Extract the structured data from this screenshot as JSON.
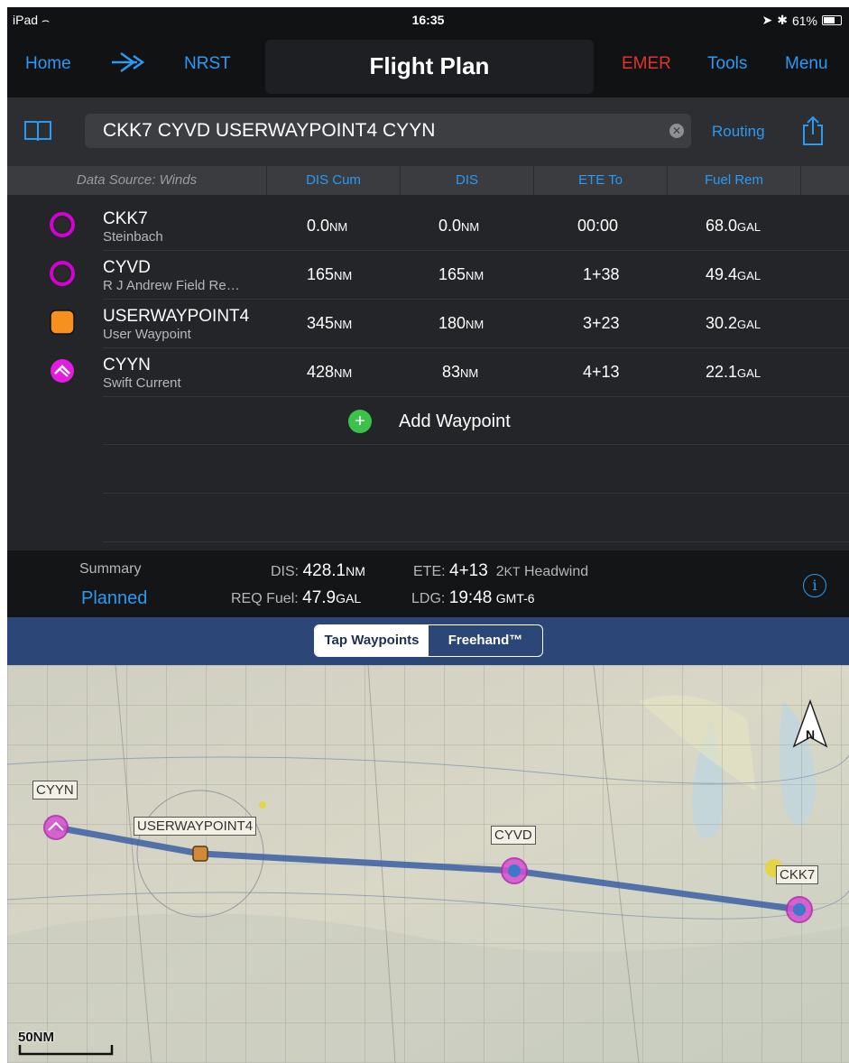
{
  "status": {
    "device": "iPad",
    "time": "16:35",
    "battery": "61%"
  },
  "nav": {
    "home": "Home",
    "direct_to_icon": "direct-to-icon",
    "nrst": "NRST",
    "title": "Flight Plan",
    "emer": "EMER",
    "tools": "Tools",
    "menu": "Menu"
  },
  "route": {
    "value": "CKK7 CYVD USERWAYPOINT4 CYYN",
    "routing": "Routing"
  },
  "table": {
    "source": "Data Source: Winds",
    "columns": [
      "DIS Cum",
      "DIS",
      "ETE To",
      "Fuel Rem"
    ]
  },
  "waypoints": [
    {
      "name": "CKK7",
      "sub": "Steinbach",
      "icon": "airport-ring-icon",
      "dis_cum": "0.0",
      "dis": "0.0",
      "ete": "00:00",
      "fuel": "68.0"
    },
    {
      "name": "CYVD",
      "sub": "R J Andrew Field Re…",
      "icon": "airport-ring-icon",
      "dis_cum": "165",
      "dis": "165",
      "ete": "1+38",
      "fuel": "49.4"
    },
    {
      "name": "USERWAYPOINT4",
      "sub": "User Waypoint",
      "icon": "user-waypoint-icon",
      "dis_cum": "345",
      "dis": "180",
      "ete": "3+23",
      "fuel": "30.2"
    },
    {
      "name": "CYYN",
      "sub": "Swift Current",
      "icon": "airport-runway-icon",
      "dis_cum": "428",
      "dis": "83",
      "ete": "4+13",
      "fuel": "22.1"
    }
  ],
  "units": {
    "nm": "NM",
    "gal": "GAL",
    "kt": "KT"
  },
  "add_waypoint": "Add Waypoint",
  "summary": {
    "title": "Summary",
    "mode": "Planned",
    "dis_label": "DIS:",
    "dis": "428.1",
    "req_label": "REQ Fuel:",
    "req": "47.9",
    "ete_label": "ETE:",
    "ete": "4+13",
    "wind": "2",
    "wind_text": "Headwind",
    "ldg_label": "LDG:",
    "ldg": "19:48",
    "tz": "GMT-6"
  },
  "map_mode": {
    "tap": "Tap Waypoints",
    "freehand": "Freehand™",
    "selected": "Tap Waypoints"
  },
  "map": {
    "labels": [
      "CYYN",
      "USERWAYPOINT4",
      "CYVD",
      "CKK7"
    ],
    "north": "N",
    "scale": "50NM",
    "route_color": "#3b5fa3",
    "airport_color": "#d64fd0"
  },
  "colors": {
    "accent": "#2b9af3",
    "emer": "#e0342b",
    "add": "#3cc24a",
    "user_wp": "#f7901e",
    "airport": "#d400d4"
  }
}
